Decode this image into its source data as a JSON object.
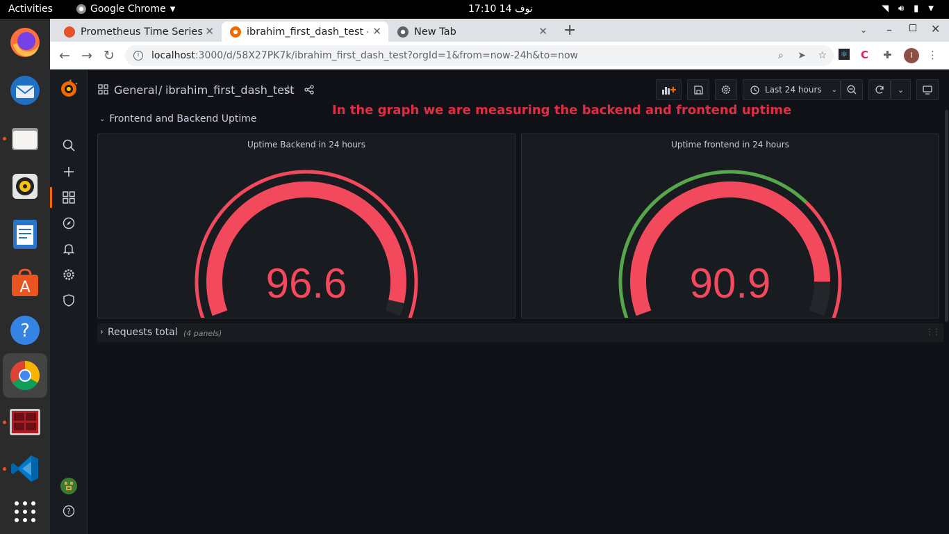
{
  "ubuntu": {
    "activities": "Activities",
    "app_name": "Google Chrome",
    "clock": "17:10  14 نوف"
  },
  "dock": {
    "items": [
      "firefox",
      "thunderbird",
      "files",
      "rhythmbox",
      "libreoffice-writer",
      "software-center",
      "help",
      "chrome",
      "terminal-tool",
      "vscode",
      "app-grid"
    ]
  },
  "browser": {
    "tabs": [
      {
        "title": "Prometheus Time Series C",
        "active": false
      },
      {
        "title": "ibrahim_first_dash_test -",
        "active": true
      },
      {
        "title": "New Tab",
        "active": false
      }
    ],
    "url_host": "localhost",
    "url_rest": ":3000/d/58X27PK7k/ibrahim_first_dash_test?orgId=1&from=now-24h&to=now",
    "profile_initial": "I"
  },
  "grafana": {
    "breadcrumb_folder": "General",
    "breadcrumb_sep": "/",
    "dashboard_title": "ibrahim_first_dash_test",
    "time_range": "Last 24 hours",
    "annotation": "In the graph we are measuring the backend and frontend uptime",
    "row1_title": "Frontend and Backend Uptime",
    "row2_title": "Requests total",
    "row2_panels": "(4 panels)",
    "panels": [
      {
        "title": "Uptime Backend in 24 hours",
        "value": "96.6",
        "fraction": 0.966,
        "threshold_green_fraction": 0.0
      },
      {
        "title": "Uptime frontend in 24 hours",
        "value": "90.9",
        "fraction": 0.909,
        "threshold_green_fraction": 0.7
      }
    ],
    "colors": {
      "red": "#f2495c",
      "green": "#56a64b",
      "annotation": "#e02f44"
    }
  }
}
